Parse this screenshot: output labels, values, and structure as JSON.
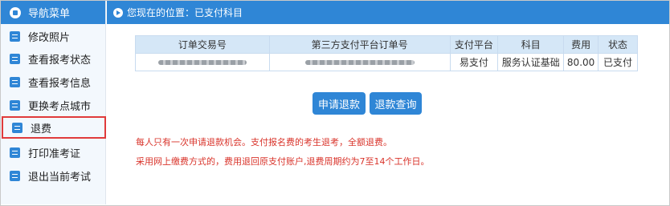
{
  "sidebar": {
    "header": "导航菜单",
    "items": [
      {
        "label": "修改照片"
      },
      {
        "label": "查看报考状态"
      },
      {
        "label": "查看报考信息"
      },
      {
        "label": "更换考点城市"
      },
      {
        "label": "退费"
      },
      {
        "label": "打印准考证"
      },
      {
        "label": "退出当前考试"
      }
    ]
  },
  "topbar": {
    "location_text": "您现在的位置：已支付科目"
  },
  "table": {
    "columns": [
      "订单交易号",
      "第三方支付平台订单号",
      "支付平台",
      "科目",
      "费用",
      "状态"
    ],
    "rows": [
      {
        "platform": "易支付",
        "subject": "服务认证基础",
        "fee": "80.00",
        "status": "已支付"
      }
    ]
  },
  "buttons": {
    "apply_refund": "申请退款",
    "query_refund": "退款查询"
  },
  "notices": {
    "line1": "每人只有一次申请退款机会。支付报名费的考生退考，全额退费。",
    "line2": "采用网上缴费方式的，费用退回原支付账户,退费周期约为7至14个工作日。"
  },
  "colors": {
    "primary": "#2f86d6",
    "notice": "#d9342b",
    "active_outline": "#e03b3b"
  }
}
